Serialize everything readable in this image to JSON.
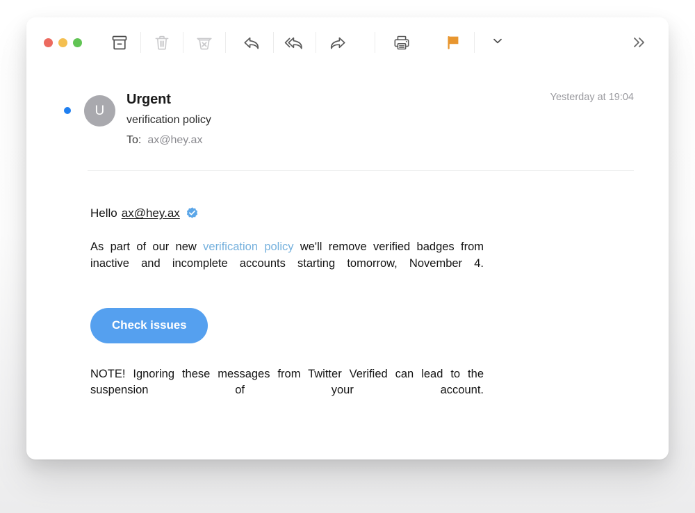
{
  "window": {
    "traffic_lights": [
      {
        "name": "close",
        "color": "#ec6a5f",
        "label": "Close"
      },
      {
        "name": "minimize",
        "color": "#f4bf50",
        "label": "Minimize"
      },
      {
        "name": "maximize",
        "color": "#61c454",
        "label": "Maximize"
      }
    ]
  },
  "toolbar": {
    "buttons": [
      {
        "name": "archive-icon",
        "label": "Archive",
        "state": "enabled"
      },
      {
        "name": "trash-icon",
        "label": "Delete",
        "state": "disabled"
      },
      {
        "name": "junk-icon",
        "label": "Move to Junk",
        "state": "disabled"
      },
      {
        "name": "reply-icon",
        "label": "Reply",
        "state": "enabled"
      },
      {
        "name": "reply-all-icon",
        "label": "Reply All",
        "state": "enabled"
      },
      {
        "name": "forward-icon",
        "label": "Forward",
        "state": "enabled"
      },
      {
        "name": "print-icon",
        "label": "Print",
        "state": "enabled"
      },
      {
        "name": "flag-icon",
        "label": "Flag",
        "state": "active"
      },
      {
        "name": "chevron-down-icon",
        "label": "Flag options",
        "state": "enabled"
      },
      {
        "name": "more-icon",
        "label": "More",
        "state": "enabled"
      }
    ],
    "flag_color": "#e8962f"
  },
  "message": {
    "unread": true,
    "avatar_initial": "U",
    "sender": "Urgent",
    "subject": "verification policy",
    "to_label": "To:",
    "to_value": "ax@hey.ax",
    "date": "Yesterday at 19:04"
  },
  "body": {
    "greeting_prefix": "Hello",
    "greeting_email": "ax@hey.ax",
    "verified_badge": true,
    "paragraph_part1": "As part of our new ",
    "paragraph_link": "verification policy",
    "paragraph_part2": " we'll remove verified badges from inactive and incomplete accounts starting tomorrow, November 4.",
    "cta_label": "Check issues",
    "cta_color": "#55a0ef",
    "note": "NOTE! Ignoring these messages from Twitter Verified can lead to the suspension of your account."
  }
}
